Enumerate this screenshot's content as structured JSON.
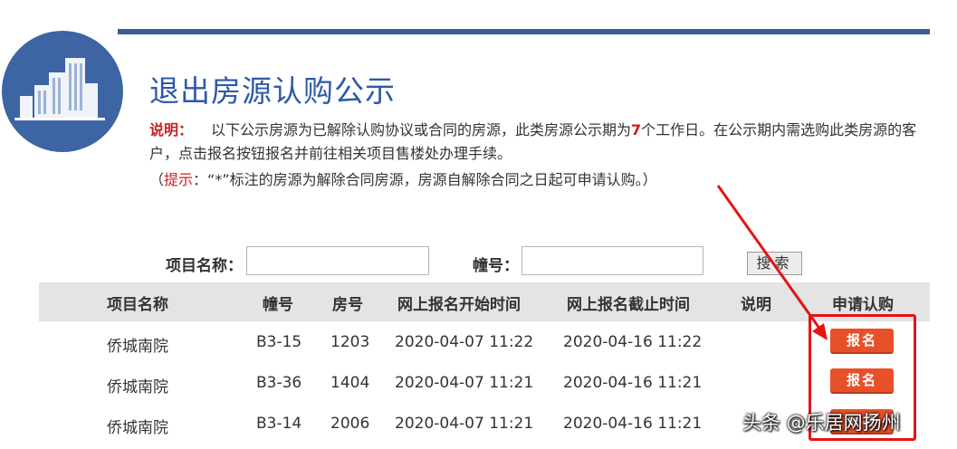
{
  "header": {
    "title": "退出房源认购公示",
    "desc_label": "说明：",
    "desc_part1": "以下公示房源为已解除认购协议或合同的房源，此类房源公示期为",
    "desc_days": "7",
    "desc_part2": "个工作日。在公示期内需选购此类房源的客户，点击报名按钮报名并前往相关项目售楼处办理手续。",
    "tip_open": "（",
    "tip_label": "提示",
    "tip_text": "：“*”标注的房源为解除合同房源，房源自解除合同之日起可申请认购。）"
  },
  "search": {
    "project_label": "项目名称：",
    "building_label": "幢号：",
    "button_label": "搜索"
  },
  "table": {
    "headers": [
      "项目名称",
      "幢号",
      "房号",
      "网上报名开始时间",
      "网上报名截止时间",
      "说明",
      "申请认购"
    ],
    "rows": [
      {
        "project": "侨城南院",
        "building": "B3-15",
        "room": "1203",
        "start": "2020-04-07 11:22",
        "end": "2020-04-16 11:22",
        "note": "",
        "action": "报名"
      },
      {
        "project": "侨城南院",
        "building": "B3-36",
        "room": "1404",
        "start": "2020-04-07 11:21",
        "end": "2020-04-16 11:21",
        "note": "",
        "action": "报名"
      },
      {
        "project": "侨城南院",
        "building": "B3-14",
        "room": "2006",
        "start": "2020-04-07 11:21",
        "end": "2020-04-16 11:21",
        "note": "",
        "action": "报名"
      }
    ]
  },
  "watermark": "头条 @乐居网扬州",
  "colors": {
    "brand_blue": "#3a5d96",
    "title_blue": "#2e5aa8",
    "label_red": "#cc1f1f",
    "button_orange": "#e8502a",
    "highlight_red": "#e41414"
  }
}
